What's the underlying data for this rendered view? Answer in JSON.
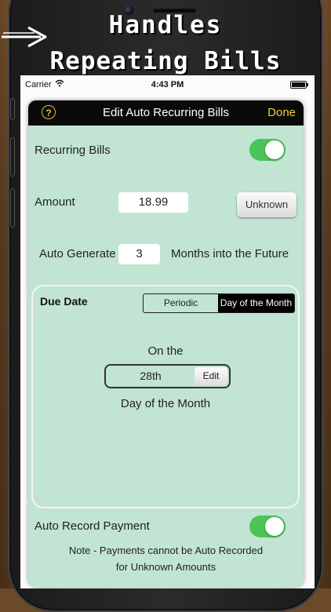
{
  "headline": {
    "line1": "Handles",
    "line2": "Repeating Bills"
  },
  "status": {
    "carrier": "Carrier",
    "time": "4:43 PM"
  },
  "navbar": {
    "help": "?",
    "title": "Edit Auto Recurring Bills",
    "done": "Done"
  },
  "form": {
    "recurring_label": "Recurring Bills",
    "recurring_on": true,
    "amount_label": "Amount",
    "amount_value": "18.99",
    "unknown_button": "Unknown",
    "auto_generate_label": "Auto Generate",
    "auto_generate_value": "3",
    "months_label": "Months into the Future"
  },
  "due_date": {
    "title": "Due Date",
    "options": [
      "Periodic",
      "Day of the Month"
    ],
    "selected": "Day of the Month",
    "on_the": "On the",
    "day_value": "28th",
    "edit_button": "Edit",
    "day_of_month_label": "Day of the Month"
  },
  "auto_record": {
    "label": "Auto Record Payment",
    "on": true,
    "note_line1": "Note - Payments cannot be Auto Recorded",
    "note_line2": "for Unknown Amounts"
  },
  "colors": {
    "panel": "#c2e4d2",
    "toggle_on": "#4dc35a",
    "accent": "#f0cc3a"
  }
}
